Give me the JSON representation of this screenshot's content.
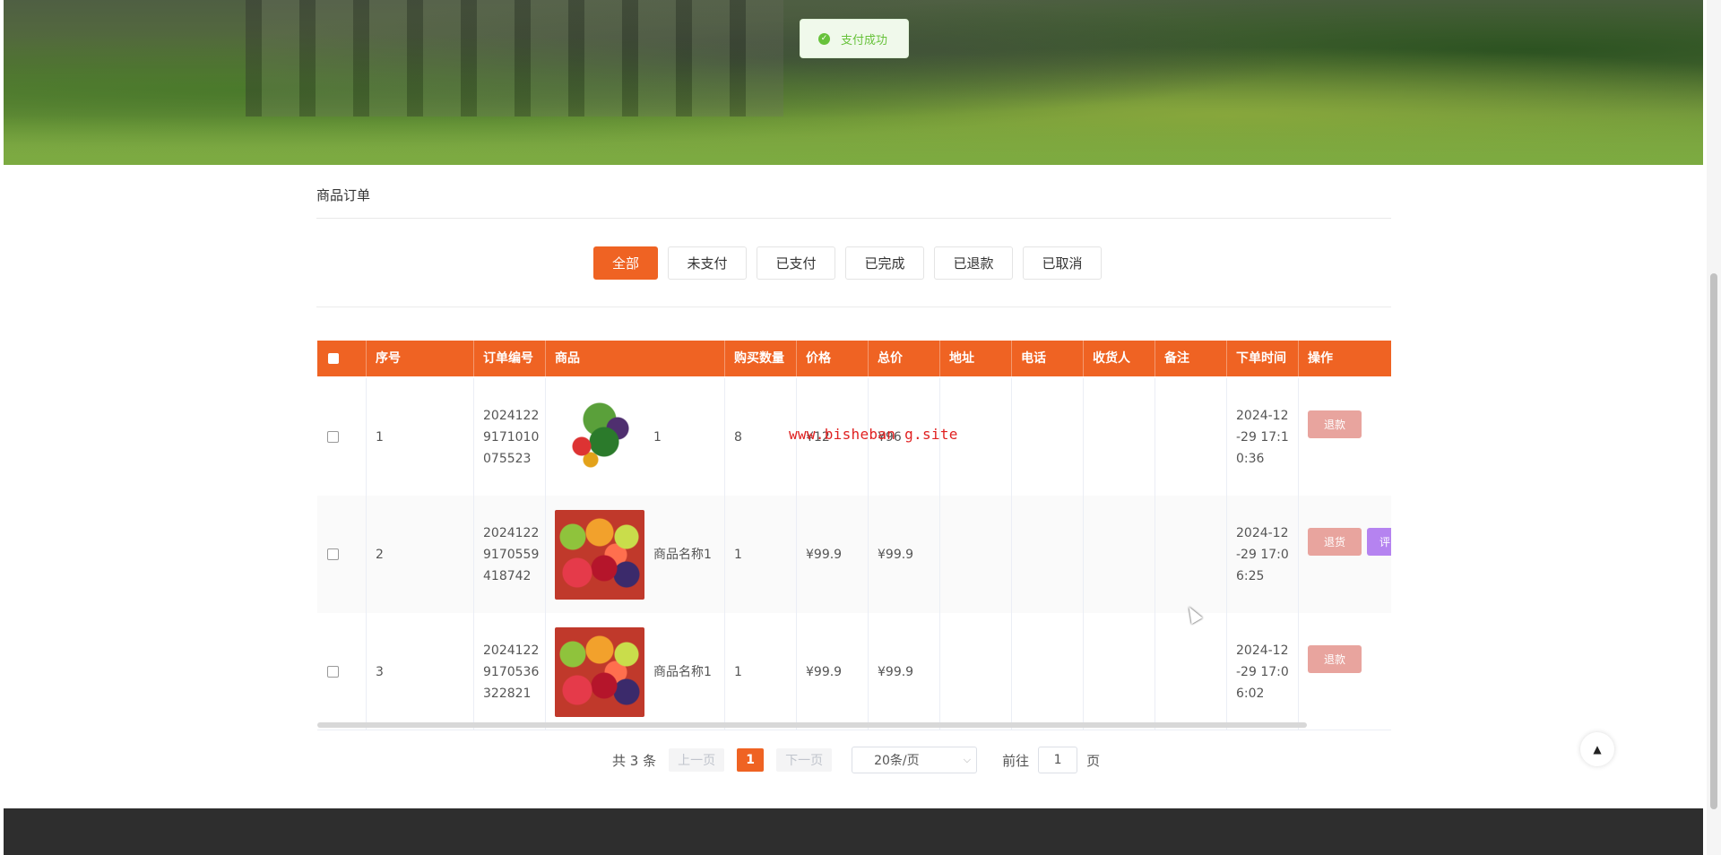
{
  "toast": {
    "message": "支付成功"
  },
  "section": {
    "title": "商品订单"
  },
  "tabs": [
    {
      "label": "全部",
      "active": true
    },
    {
      "label": "未支付",
      "active": false
    },
    {
      "label": "已支付",
      "active": false
    },
    {
      "label": "已完成",
      "active": false
    },
    {
      "label": "已退款",
      "active": false
    },
    {
      "label": "已取消",
      "active": false
    }
  ],
  "table": {
    "headers": [
      "序号",
      "订单编号",
      "商品",
      "购买数量",
      "价格",
      "总价",
      "地址",
      "电话",
      "收货人",
      "备注",
      "下单时间",
      "操作"
    ],
    "rows": [
      {
        "index": "1",
        "order_no": "20241229171010075523",
        "product_name": "1",
        "image": "vegetables",
        "quantity": "8",
        "price": "¥12",
        "total": "¥96",
        "address": "",
        "phone": "",
        "receiver": "",
        "remark": "",
        "order_time": "2024-12-29 17:10:36",
        "actions": [
          "退款"
        ]
      },
      {
        "index": "2",
        "order_no": "20241229170559418742",
        "product_name": "商品名称1",
        "image": "fruits",
        "quantity": "1",
        "price": "¥99.9",
        "total": "¥99.9",
        "address": "",
        "phone": "",
        "receiver": "",
        "remark": "",
        "order_time": "2024-12-29 17:06:25",
        "actions": [
          "退货",
          "评"
        ]
      },
      {
        "index": "3",
        "order_no": "20241229170536322821",
        "product_name": "商品名称1",
        "image": "fruits",
        "quantity": "1",
        "price": "¥99.9",
        "total": "¥99.9",
        "address": "",
        "phone": "",
        "receiver": "",
        "remark": "",
        "order_time": "2024-12-29 17:06:02",
        "actions": [
          "退款"
        ]
      }
    ]
  },
  "watermark": "www.bisheban g.site",
  "pagination": {
    "total_text": "共 3 条",
    "prev_label": "上一页",
    "current_page": "1",
    "next_label": "下一页",
    "page_size": "20条/页",
    "goto_label": "前往",
    "goto_value": "1",
    "page_suffix": "页"
  },
  "colors": {
    "accent": "#ef6323",
    "refund_button": "#e8a49e",
    "review_button": "#b583f0",
    "success": "#67c23a",
    "footer": "#2e2e2e"
  },
  "icons": {
    "toast": "check-circle-icon",
    "back_to_top": "caret-up-icon",
    "page_size": "chevron-down-icon"
  }
}
